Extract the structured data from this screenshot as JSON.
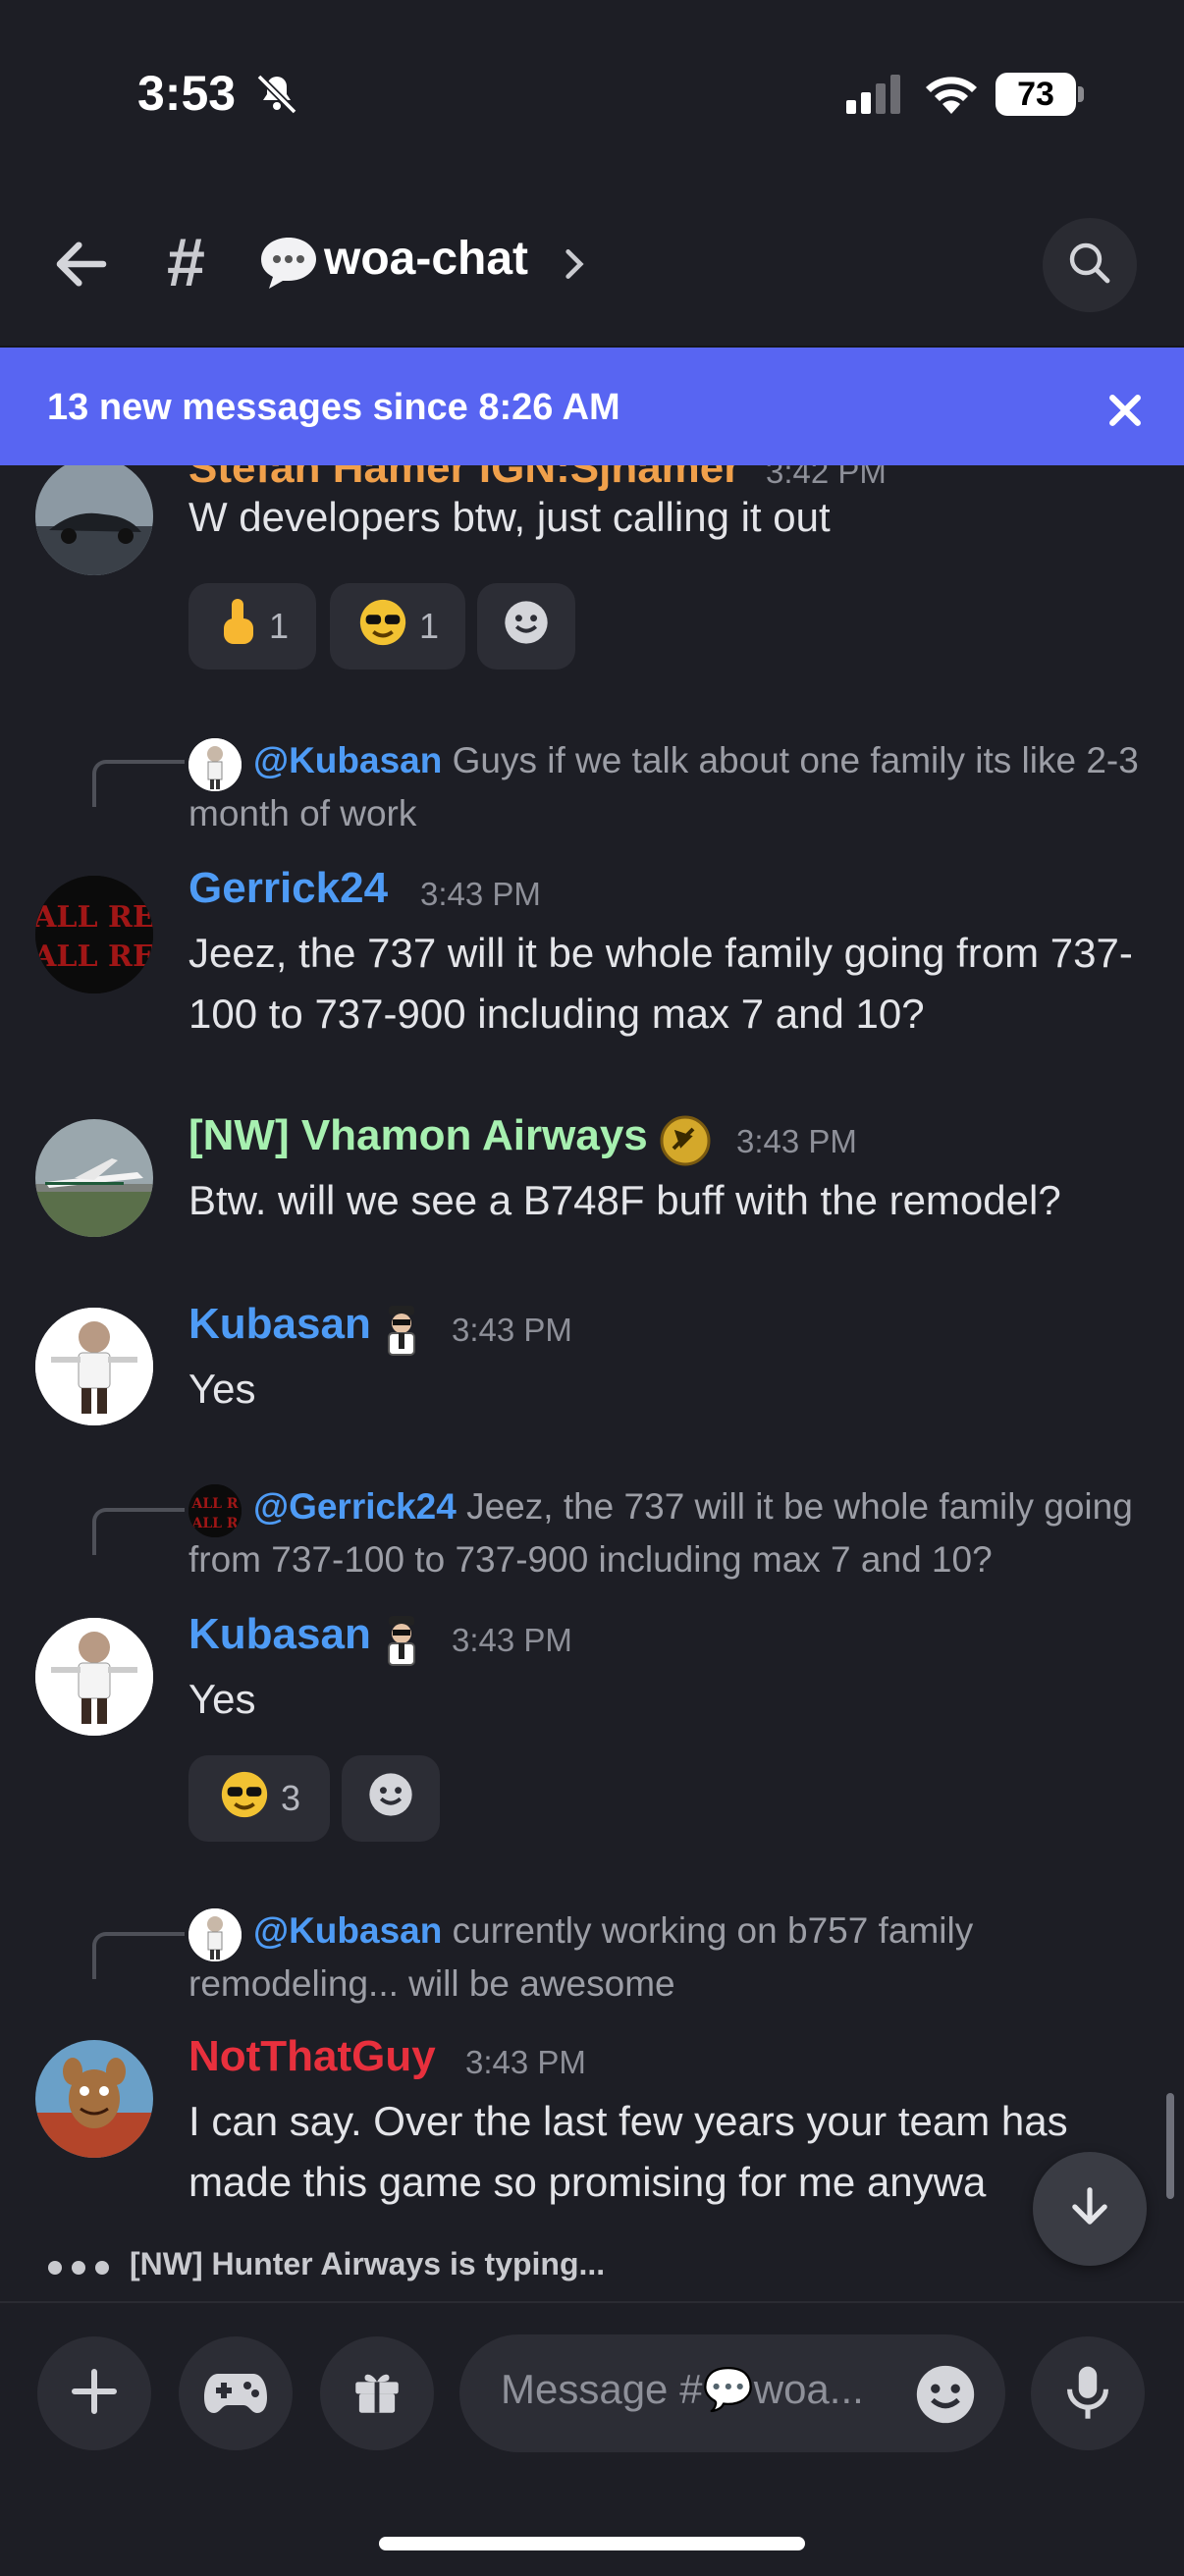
{
  "status": {
    "time": "3:53",
    "battery": "73"
  },
  "header": {
    "channel_name": "woa-chat"
  },
  "banner": {
    "text": "13 new messages since 8:26 AM"
  },
  "messages": [
    {
      "author": "Stefan Hamer IGN:Sjhamer",
      "time": "3:42 PM",
      "text": "W developers btw, just calling it out",
      "reactions": [
        {
          "count": "1"
        },
        {
          "count": "1"
        }
      ]
    },
    {
      "reply_to": "@Kubasan",
      "reply_text": "Guys if we talk about one family its like 2-3 month of work",
      "author": "Gerrick24",
      "time": "3:43 PM",
      "text": "Jeez, the 737 will it be whole family going from 737-100 to 737-900 including max 7 and 10?"
    },
    {
      "author": "[NW] Vhamon Airways",
      "time": "3:43 PM",
      "text": "Btw. will we see a B748F buff with the remodel?"
    },
    {
      "author": "Kubasan",
      "time": "3:43 PM",
      "text": "Yes"
    },
    {
      "reply_to": "@Gerrick24",
      "reply_text": "Jeez, the 737 will it be whole family going from 737-100 to 737-900 including max 7 and 10?",
      "author": "Kubasan",
      "time": "3:43 PM",
      "text": "Yes",
      "reactions": [
        {
          "count": "3"
        }
      ]
    },
    {
      "reply_to": "@Kubasan",
      "reply_text": "currently working on b757 family remodeling... will be awesome",
      "author": "NotThatGuy",
      "time": "3:43 PM",
      "text": "I can say. Over the last few years your team has made this game so promising for me anywa"
    }
  ],
  "typing": {
    "text": "[NW] Hunter Airways is typing..."
  },
  "composer": {
    "placeholder": "Message #💬woa..."
  },
  "colors": {
    "banner": "#5865f2",
    "orange_user": "#f0a04b",
    "blue_user": "#4e9bf5",
    "green_user": "#a7f0b0",
    "red_user": "#e8303d"
  }
}
